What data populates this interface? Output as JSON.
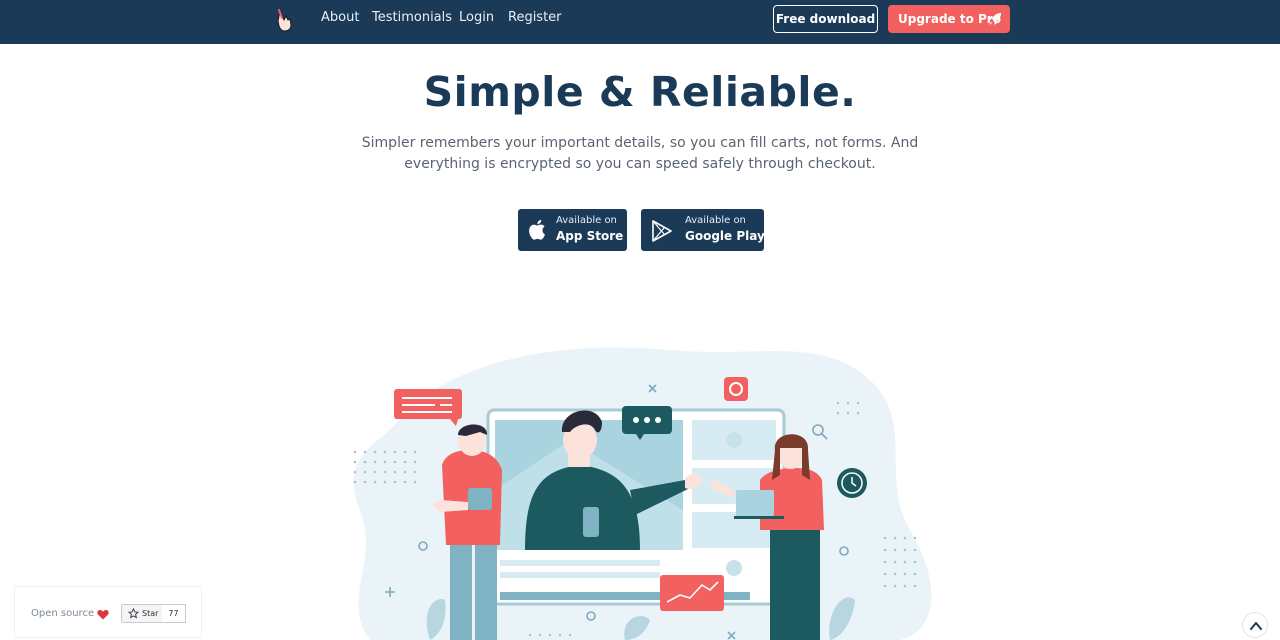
{
  "nav": {
    "logo": "hand-pointer-icon",
    "links": [
      "About",
      "Testimonials",
      "Login",
      "Register"
    ],
    "free_download": "Free download",
    "upgrade": "Upgrade to Pro",
    "upgrade_icon": "rocket-icon"
  },
  "hero": {
    "title": "Simple & Reliable.",
    "subtitle": "Simpler remembers your important details, so you can fill carts, not forms. And everything is encrypted so you can speed safely through checkout."
  },
  "stores": {
    "apple": {
      "small": "Available on",
      "big": "App Store",
      "icon": "apple-icon"
    },
    "google": {
      "small": "Available on",
      "big": "Google Play",
      "icon": "google-play-icon"
    }
  },
  "open_source": {
    "label": "Open source",
    "heart_icon": "heart-icon",
    "star_label": "Star",
    "star_count": "77"
  },
  "scroll_top_icon": "chevron-up-icon",
  "colors": {
    "navy": "#1b3a57",
    "coral": "#f2615f",
    "teal": "#1d5a5f",
    "light_blue": "#e4f1f6"
  }
}
